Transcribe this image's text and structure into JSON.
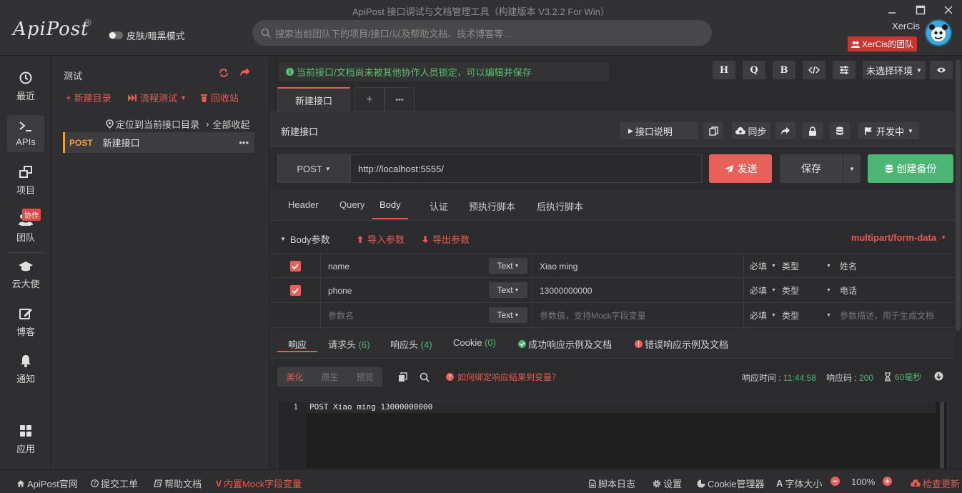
{
  "window": {
    "title": "ApiPost 接口调试与文档管理工具（构建版本 V3.2.2 For Win）"
  },
  "header": {
    "logo": "ApiPost",
    "logo_mark": "®",
    "theme_label": "皮肤/暗黑模式",
    "search_placeholder": "搜索当前团队下的项目/接口/以及帮助文档、技术博客等...",
    "user_name": "XerCis",
    "team_name": "XerCis的团队"
  },
  "leftnav": {
    "items": [
      {
        "label": "最近",
        "icon": "clock-icon"
      },
      {
        "label": "APIs",
        "icon": "terminal-icon"
      },
      {
        "label": "项目",
        "icon": "project-icon"
      },
      {
        "label": "团队",
        "icon": "team-icon",
        "tag": "协作"
      },
      {
        "label": "云大使",
        "icon": "graduation-cap-icon"
      },
      {
        "label": "博客",
        "icon": "edit-icon"
      },
      {
        "label": "通知",
        "icon": "bell-icon"
      },
      {
        "label": "应用",
        "icon": "apps-grid-icon"
      }
    ]
  },
  "panel": {
    "project_name": "测试",
    "new_dir": "新建目录",
    "flow_test": "流程测试",
    "recycle": "回收站",
    "locate": "定位到当前接口目录",
    "collapse_all": "全部收起",
    "tree": [
      {
        "method": "POST",
        "name": "新建接口"
      }
    ]
  },
  "main": {
    "lock_msg": "当前接口/文档尚未被其他协作人员锁定，可以编辑并保存",
    "toolbar": {
      "h": "H",
      "q": "Q",
      "b": "B",
      "env": "未选择环境"
    },
    "doc_tab": "新建接口",
    "api_name": "新建接口",
    "api_desc_btn": "接口说明",
    "sync_btn": "同步",
    "status_btn": "开发中",
    "method": "POST",
    "url": "http://localhost:5555/",
    "send": "发送",
    "save": "保存",
    "backup": "创建备份",
    "req_tabs": [
      "Header",
      "Query",
      "Body",
      "认证",
      "预执行脚本",
      "后执行脚本"
    ],
    "body_label": "Body参数",
    "import_params": "导入参数",
    "export_params": "导出参数",
    "content_type": "multipart/form-data",
    "params": [
      {
        "name": "name",
        "type": "Text",
        "value": "Xiao ming",
        "required": "必填",
        "type_label": "类型",
        "desc": "姓名"
      },
      {
        "name": "phone",
        "type": "Text",
        "value": "13000000000",
        "required": "必填",
        "type_label": "类型",
        "desc": "电话"
      }
    ],
    "param_placeholder": {
      "name": "参数名",
      "type": "Text",
      "value": "参数值，支持Mock字段变量",
      "required": "必填",
      "type_label": "类型",
      "desc": "参数描述，用于生成文档"
    },
    "resp_tabs": {
      "response": "响应",
      "req_headers": "请求头",
      "req_headers_count": "(6)",
      "resp_headers": "响应头",
      "resp_headers_count": "(4)",
      "cookie": "Cookie",
      "cookie_count": "(0)",
      "success_example": "成功响应示例及文档",
      "error_example": "错误响应示例及文档"
    },
    "format": [
      "美化",
      "原生",
      "预览"
    ],
    "bind_hint": "如何绑定响应结果到变量？",
    "resp_time_label": "响应时间 : ",
    "resp_time": "11:44:58",
    "resp_code_label": "响应码 : ",
    "resp_code": "200",
    "resp_duration": "60毫秒",
    "code": {
      "line_no": "1",
      "text": "POST Xiao ming 13000000000"
    }
  },
  "statusbar": {
    "site": "ApiPost官网",
    "ticket": "提交工单",
    "help": "帮助文档",
    "mock": "内置Mock字段变量",
    "log": "脚本日志",
    "settings": "设置",
    "cookie_mgr": "Cookie管理器",
    "font_size": "字体大小",
    "zoom": "100%",
    "update": "检查更新"
  },
  "colors": {
    "accent_red": "#e8605a",
    "green": "#4cb774",
    "orange": "#f0a033",
    "bg": "#2b2b2d"
  }
}
